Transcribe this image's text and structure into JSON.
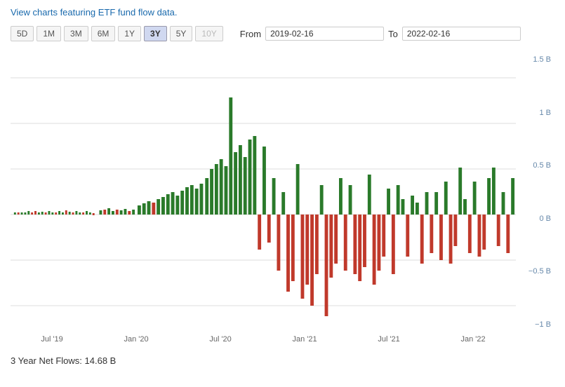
{
  "header": {
    "link_text": "View charts featuring ETF fund flow data."
  },
  "controls": {
    "time_buttons": [
      {
        "label": "5D",
        "active": false,
        "disabled": false
      },
      {
        "label": "1M",
        "active": false,
        "disabled": false
      },
      {
        "label": "3M",
        "active": false,
        "disabled": false
      },
      {
        "label": "6M",
        "active": false,
        "disabled": false
      },
      {
        "label": "1Y",
        "active": false,
        "disabled": false
      },
      {
        "label": "3Y",
        "active": true,
        "disabled": false
      },
      {
        "label": "5Y",
        "active": false,
        "disabled": false
      },
      {
        "label": "10Y",
        "active": false,
        "disabled": true
      }
    ],
    "from_label": "From",
    "to_label": "To",
    "from_date": "2019-02-16",
    "to_date": "2022-02-16"
  },
  "y_axis": {
    "labels": [
      "1.5 B",
      "1 B",
      "0.5 B",
      "0 B",
      "-0.5 B",
      "-1 B"
    ]
  },
  "x_axis": {
    "labels": [
      "Jul '19",
      "Jan '20",
      "Jul '20",
      "Jan '21",
      "Jul '21",
      "Jan '22"
    ]
  },
  "footer": {
    "label": "3 Year Net Flows:",
    "value": "14.68 B"
  },
  "chart": {
    "bars": [
      {
        "x": 12,
        "positive": true,
        "height_pct": 1
      },
      {
        "x": 14,
        "positive": false,
        "height_pct": 0.5
      },
      {
        "x": 16,
        "positive": true,
        "height_pct": 0.5
      },
      {
        "x": 18,
        "positive": false,
        "height_pct": 0.5
      },
      {
        "x": 20,
        "positive": true,
        "height_pct": 0.5
      },
      {
        "x": 22,
        "positive": false,
        "height_pct": 0.5
      },
      {
        "x": 25,
        "positive": false,
        "height_pct": 1
      },
      {
        "x": 27,
        "positive": true,
        "height_pct": 1
      },
      {
        "x": 30,
        "positive": false,
        "height_pct": 0.5
      },
      {
        "x": 32,
        "positive": false,
        "height_pct": 0.5
      },
      {
        "x": 35,
        "positive": true,
        "height_pct": 1
      },
      {
        "x": 37,
        "positive": false,
        "height_pct": 0.5
      },
      {
        "x": 40,
        "positive": false,
        "height_pct": 0.5
      },
      {
        "x": 42,
        "positive": true,
        "height_pct": 0.5
      }
    ]
  }
}
